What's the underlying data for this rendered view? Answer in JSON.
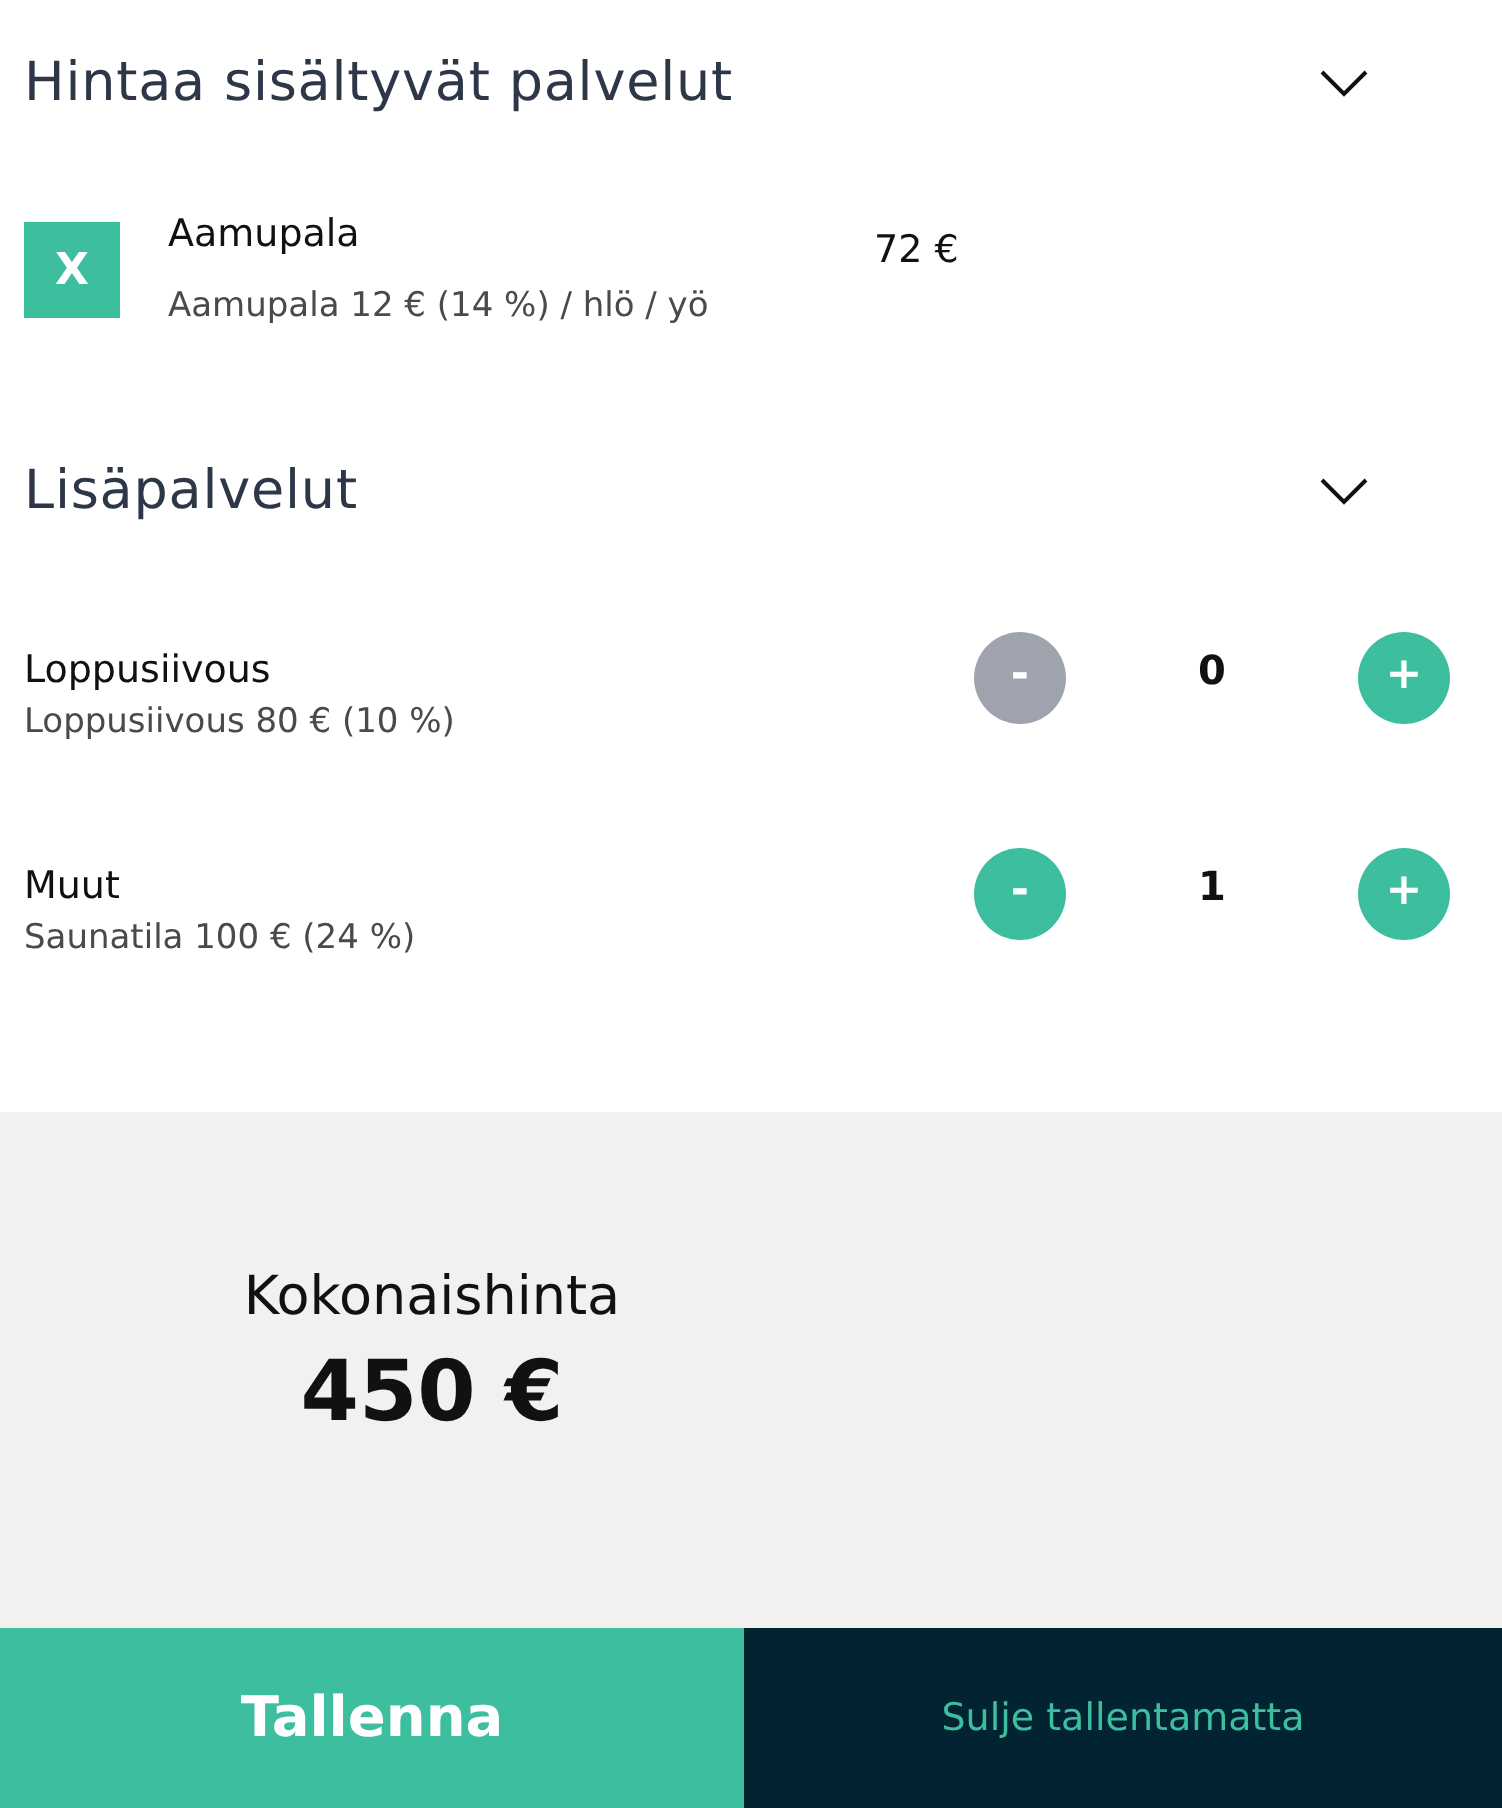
{
  "sections": [
    {
      "kind": "included",
      "title": "Hintaa sisältyvät palvelut",
      "expanded": true,
      "items": [
        {
          "badge": "X",
          "name": "Aamupala",
          "detail": "Aamupala 12 € (14 %) / hlö / yö",
          "price": "72 €"
        }
      ]
    },
    {
      "kind": "extras",
      "title": "Lisäpalvelut",
      "expanded": true,
      "items": [
        {
          "name": "Loppusiivous",
          "detail": "Loppusiivous 80 € (10 %)",
          "minus": {
            "label": "-",
            "disabled": true
          },
          "count": "0",
          "plus": {
            "label": "+",
            "disabled": false
          }
        },
        {
          "name": "Muut",
          "detail": "Saunatila 100 € (24 %)",
          "minus": {
            "label": "-",
            "disabled": false
          },
          "count": "1",
          "plus": {
            "label": "+",
            "disabled": false
          }
        }
      ]
    }
  ],
  "total": {
    "label": "Kokonaishinta",
    "value": "450 €"
  },
  "buttons": [
    {
      "kind": "primary",
      "label": "Tallenna"
    },
    {
      "kind": "secondary",
      "label": "Sulje tallentamatta"
    }
  ]
}
